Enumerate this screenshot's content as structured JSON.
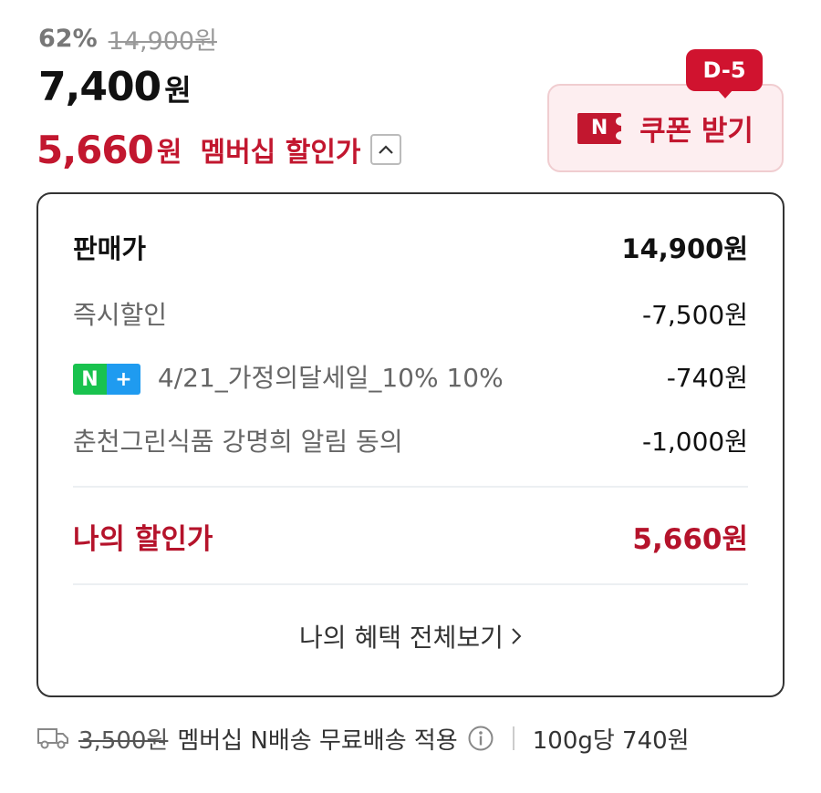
{
  "price": {
    "discount_rate": "62%",
    "original": "14,900원",
    "sale_number": "7,400",
    "sale_unit": "원",
    "member_number": "5,660",
    "member_unit": "원",
    "member_label": "멤버십 할인가"
  },
  "coupon": {
    "dday": "D-5",
    "badge": "N",
    "label": "쿠폰 받기"
  },
  "breakdown": {
    "list_price": {
      "label": "판매가",
      "value": "14,900원"
    },
    "instant": {
      "label": "즉시할인",
      "value": "-7,500원"
    },
    "nplus": {
      "badge_n": "N",
      "badge_plus": "+",
      "label": "4/21_가정의달세일_10% 10%",
      "value": "-740원"
    },
    "agree": {
      "label": "춘천그린식품 강명희 알림 동의",
      "value": "-1,000원"
    },
    "my_price": {
      "label": "나의 할인가",
      "value": "5,660원"
    },
    "view_all": "나의 혜택 전체보기"
  },
  "shipping": {
    "old_fee": "3,500원",
    "text": "멤버십 N배송 무료배송 적용",
    "unit_price": "100g당 740원"
  },
  "colors": {
    "accent": "#c2172f",
    "naver_green": "#19c24e",
    "naver_blue": "#1f9bf0"
  },
  "icons": [
    "chevron-up-icon",
    "naver-n-coupon-icon",
    "chevron-right-icon",
    "truck-icon",
    "info-icon"
  ]
}
